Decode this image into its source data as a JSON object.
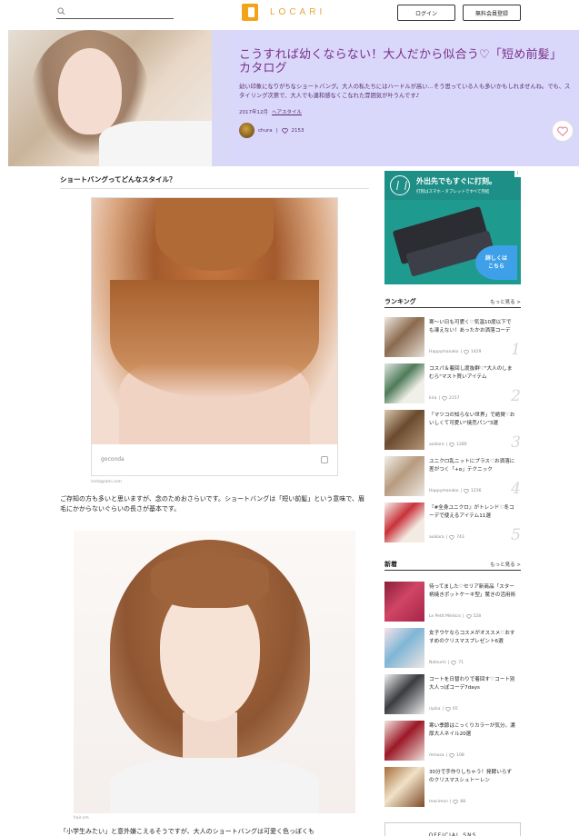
{
  "header": {
    "search_placeholder": "",
    "logo_text": "LOCARI",
    "login_label": "ログイン",
    "register_label": "無料会員登録"
  },
  "hero": {
    "title": "こうすれば幼くならない！大人だから似合う♡「短め前髪」カタログ",
    "lead": "幼い印象になりがちなショートバング。大人の私たちにはハードルが高い…そう思っている人も多いかもしれませんね。でも、スタイリング次第で、大人でも違和感なくこなれた雰囲気が叶うんです♪",
    "date": "2017年12月",
    "category": "ヘアスタイル",
    "author": "chura",
    "likes": "2153"
  },
  "article": {
    "section_heading": "ショートバングってどんなスタイル？",
    "figure1_credit": "goconda",
    "figure1_source": "instagram.com",
    "paragraph1": "ご存知の方も多いと思いますが、念のためおさらいです。ショートバングは「短い前髪」という意味で、眉毛にかからないぐらいの長さが基本です。",
    "figure2_source": "hair.cm",
    "paragraph2": "「小学生みたい」と意外嫌こえるそうですが、大人のショートバングは可愛く色っぽくも"
  },
  "ad": {
    "headline": "外出先でもすぐに打刻。",
    "subline": "打刻はスマホ・タブレットですべて完結",
    "cta": [
      "詳しくは",
      "こちら"
    ],
    "info": "i"
  },
  "ranking": {
    "heading": "ランキング",
    "more": "もっと見る >",
    "items": [
      {
        "title": "寒〜い日も可愛く♡気温10度以下でも凍えない！あったかお洒落コーデ",
        "author": "Happymanako",
        "likes": "1429",
        "num": "1"
      },
      {
        "title": "コスパ＆着回し度抜群♡\"大人のしまむら\"マスト買いアイテム",
        "author": "kira",
        "likes": "2157",
        "num": "2"
      },
      {
        "title": "「マツコの知らない世界」で絶賛♡おいしくて可愛い\"焼売パン\"3選",
        "author": "aoikara",
        "likes": "1280",
        "num": "3"
      },
      {
        "title": "ユニクロ乱ニットにプラス♡お洒落に差がつく「+α」テクニック",
        "author": "Happymanako",
        "likes": "1236",
        "num": "4"
      },
      {
        "title": "『#全身ユニクロ』がトレンド♡冬コーデで使えるアイテム11選",
        "author": "aoikara",
        "likes": "743",
        "num": "5"
      }
    ]
  },
  "newest": {
    "heading": "新着",
    "more": "もっと見る >",
    "items": [
      {
        "title": "待ってました♡セリア新商品「スター柄焼きポットケーキ型」驚きの活用術",
        "author": "Le Petit Médicis",
        "likes": "528"
      },
      {
        "title": "女子ウケならコスメがオススメ♡おすすめのクリスマスプレゼント6選",
        "author": "Natsumi",
        "likes": "71"
      },
      {
        "title": "コートを日替わりで着回す♡コート別大人っぽコーデ7days",
        "author": "ripika",
        "likes": "65"
      },
      {
        "title": "寒い季節はこっくりカラーが気分。濃厚大人ネイル20選",
        "author": "mmosa",
        "likes": "108"
      },
      {
        "title": "30分で手作りしちゃう！発酵いらずのクリスマスシュトーレン",
        "author": "macimon",
        "likes": "88"
      }
    ]
  },
  "official": {
    "label": "OFFICIAL SNS"
  },
  "colors": {
    "accent": "#e9a33b",
    "hero_bg": "#d9d8fa",
    "title": "#7a2f8c",
    "ad_bg": "#1f9a8f"
  }
}
